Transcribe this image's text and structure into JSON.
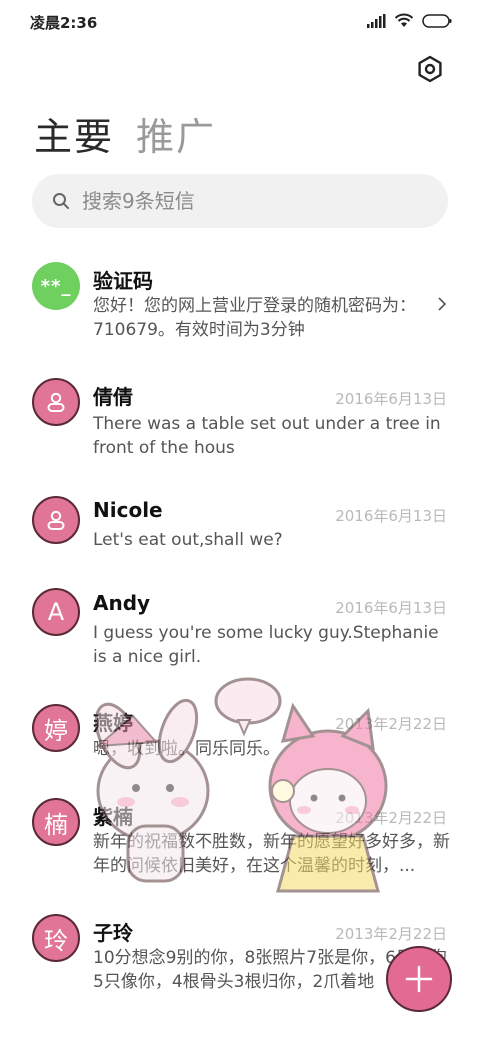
{
  "status_bar": {
    "time": "凌晨2:36"
  },
  "tabs": [
    {
      "label": "主要"
    },
    {
      "label": "推广"
    }
  ],
  "search": {
    "placeholder": "搜索9条短信"
  },
  "conversations": [
    {
      "name": "验证码",
      "avatar": "**_",
      "date": "",
      "preview": "您好！您的网上营业厅登录的随机密码为：710679。有效时间为3分钟"
    },
    {
      "name": "倩倩",
      "avatar": "",
      "date": "2016年6月13日",
      "preview": "There was a table set out under a tree in front of the hous"
    },
    {
      "name": "Nicole",
      "avatar": "",
      "date": "2016年6月13日",
      "preview": "Let's eat out,shall we?"
    },
    {
      "name": "Andy",
      "avatar": "A",
      "date": "2016年6月13日",
      "preview": "I guess you're some lucky guy.Stephanie is a nice girl."
    },
    {
      "name": "燕婷",
      "avatar": "婷",
      "date": "2013年2月22日",
      "preview": "嗯，收到啦。同乐同乐。"
    },
    {
      "name": "紫楠",
      "avatar": "楠",
      "date": "2013年2月22日",
      "preview": "新年的祝福数不胜数，新年的愿望好多好多，新年的问候依旧美好，在这个温馨的时刻，..."
    },
    {
      "name": "子玲",
      "avatar": "玲",
      "date": "2013年2月22日",
      "preview": "10分想念9别的你，8张照片7张是你，6只小狗5只像你，4根骨头3根归你，2爪着地"
    }
  ],
  "colors": {
    "avatar_pink": "#e07596",
    "avatar_green": "#6fd05f",
    "fab": "#e36b93"
  },
  "icons": [
    "settings-icon",
    "search-icon",
    "chevron-right-icon",
    "user-icon",
    "plus-icon",
    "signal-icon",
    "wifi-icon",
    "battery-icon"
  ]
}
